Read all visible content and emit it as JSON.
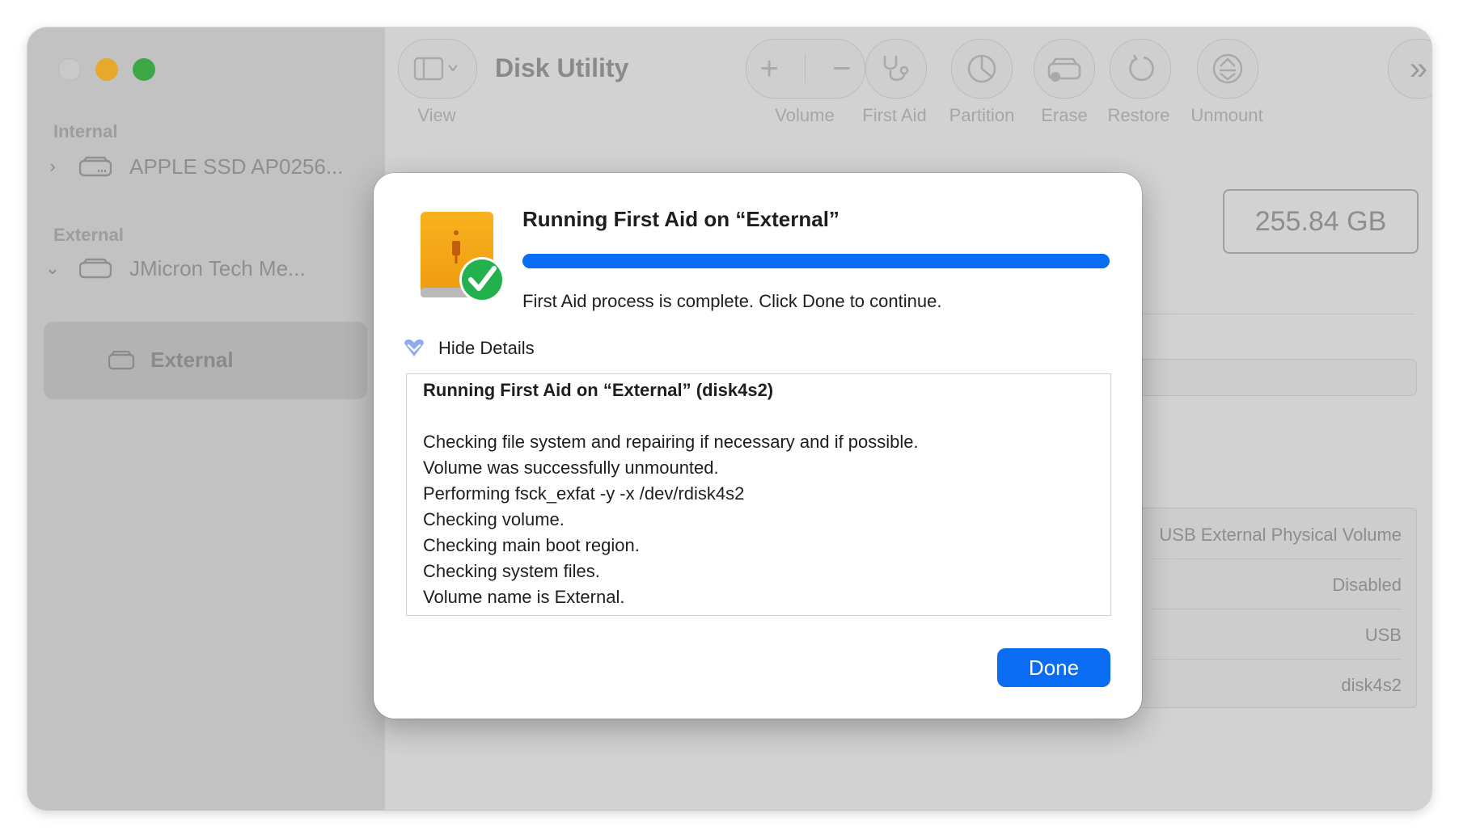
{
  "app": {
    "title": "Disk Utility"
  },
  "toolbar": {
    "view_label": "View",
    "volume_label": "Volume",
    "first_aid_label": "First Aid",
    "partition_label": "Partition",
    "erase_label": "Erase",
    "restore_label": "Restore",
    "unmount_label": "Unmount"
  },
  "sidebar": {
    "internal_header": "Internal",
    "internal_disk": "APPLE SSD AP0256...",
    "external_header": "External",
    "external_disk": "JMicron Tech Me...",
    "external_volume": "External"
  },
  "main": {
    "capacity": "255.84 GB",
    "info_rows": [
      "USB External Physical Volume",
      "Disabled",
      "USB",
      "disk4s2"
    ]
  },
  "dialog": {
    "title": "Running First Aid on “External”",
    "progress": 1.0,
    "message": "First Aid process is complete. Click Done to continue.",
    "hide_details": "Hide Details",
    "log_title": "Running First Aid on “External” (disk4s2)",
    "log_lines": [
      "Checking file system and repairing if necessary and if possible.",
      "Volume was successfully unmounted.",
      "Performing fsck_exfat -y -x /dev/rdisk4s2",
      "Checking volume.",
      "Checking main boot region.",
      "Checking system files.",
      "Volume name is External."
    ],
    "done_label": "Done"
  }
}
